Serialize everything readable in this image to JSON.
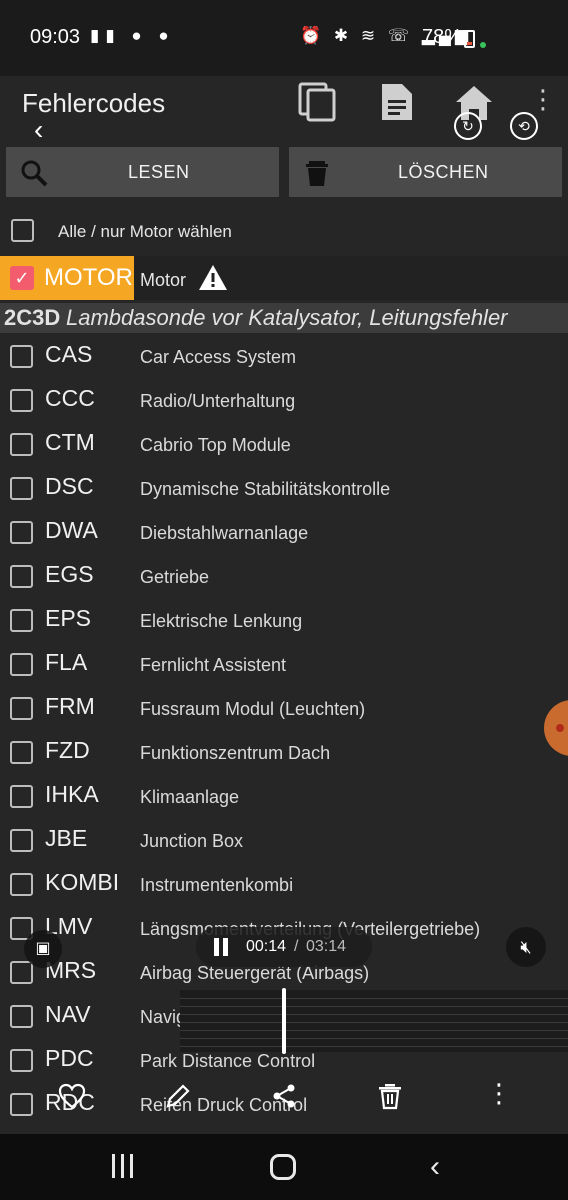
{
  "status_bar": {
    "time": "09:03",
    "battery": "78%"
  },
  "app_bar": {
    "title": "Fehlercodes"
  },
  "actions": {
    "read_label": "LESEN",
    "delete_label": "LÖSCHEN"
  },
  "select_all": {
    "label": "Alle / nur Motor wählen"
  },
  "motor": {
    "code": "MOTOR",
    "description": "Motor",
    "checked": true
  },
  "fault": {
    "code": "2C3D",
    "description": "Lambdasonde vor Katalysator, Leitungsfehler"
  },
  "modules": [
    {
      "code": "CAS",
      "description": "Car Access System"
    },
    {
      "code": "CCC",
      "description": "Radio/Unterhaltung"
    },
    {
      "code": "CTM",
      "description": "Cabrio Top Module"
    },
    {
      "code": "DSC",
      "description": "Dynamische Stabilitätskontrolle"
    },
    {
      "code": "DWA",
      "description": "Diebstahlwarnanlage"
    },
    {
      "code": "EGS",
      "description": "Getriebe"
    },
    {
      "code": "EPS",
      "description": "Elektrische Lenkung"
    },
    {
      "code": "FLA",
      "description": "Fernlicht Assistent"
    },
    {
      "code": "FRM",
      "description": "Fussraum Modul (Leuchten)"
    },
    {
      "code": "FZD",
      "description": "Funktionszentrum Dach"
    },
    {
      "code": "IHKA",
      "description": "Klimaanlage"
    },
    {
      "code": "JBE",
      "description": "Junction Box"
    },
    {
      "code": "KOMBI",
      "description": "Instrumentenkombi"
    },
    {
      "code": "LMV",
      "description": "Längsmomentverteilung (Verteilergetriebe)"
    },
    {
      "code": "MRS",
      "description": "Airbag Steuergerät (Airbags)"
    },
    {
      "code": "NAV",
      "description": "Navig"
    },
    {
      "code": "PDC",
      "description": "Park Distance Control"
    },
    {
      "code": "RDC",
      "description": "Reifen Druck Control"
    }
  ],
  "video_player": {
    "current_time": "00:14",
    "separator": "/",
    "total_time": "03:14"
  },
  "colors": {
    "background": "#262626",
    "button": "#4a4a4a",
    "motor_highlight": "#f5a623",
    "checkbox_checked": "#f25c6c",
    "fault_row": "#3c3c3c"
  }
}
